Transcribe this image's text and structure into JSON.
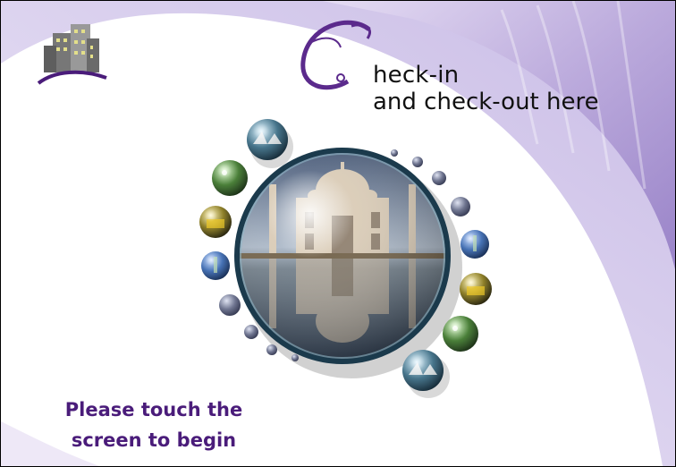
{
  "header": {
    "title_initial": "C",
    "title_line1": "heck-in",
    "title_line2": "and check-out here"
  },
  "prompt": {
    "line1": "Please touch the",
    "line2": "screen to begin"
  },
  "colors": {
    "accent_purple": "#4a1c7a",
    "lavender": "#b6a4d8",
    "text_dark": "#111111"
  },
  "icons": {
    "logo": "hotel-building-icon",
    "center": "taj-mahal-image",
    "bubbles": [
      "opera-house-thumb",
      "night-scene-thumb",
      "taxi-thumb",
      "statue-of-liberty-thumb"
    ]
  }
}
